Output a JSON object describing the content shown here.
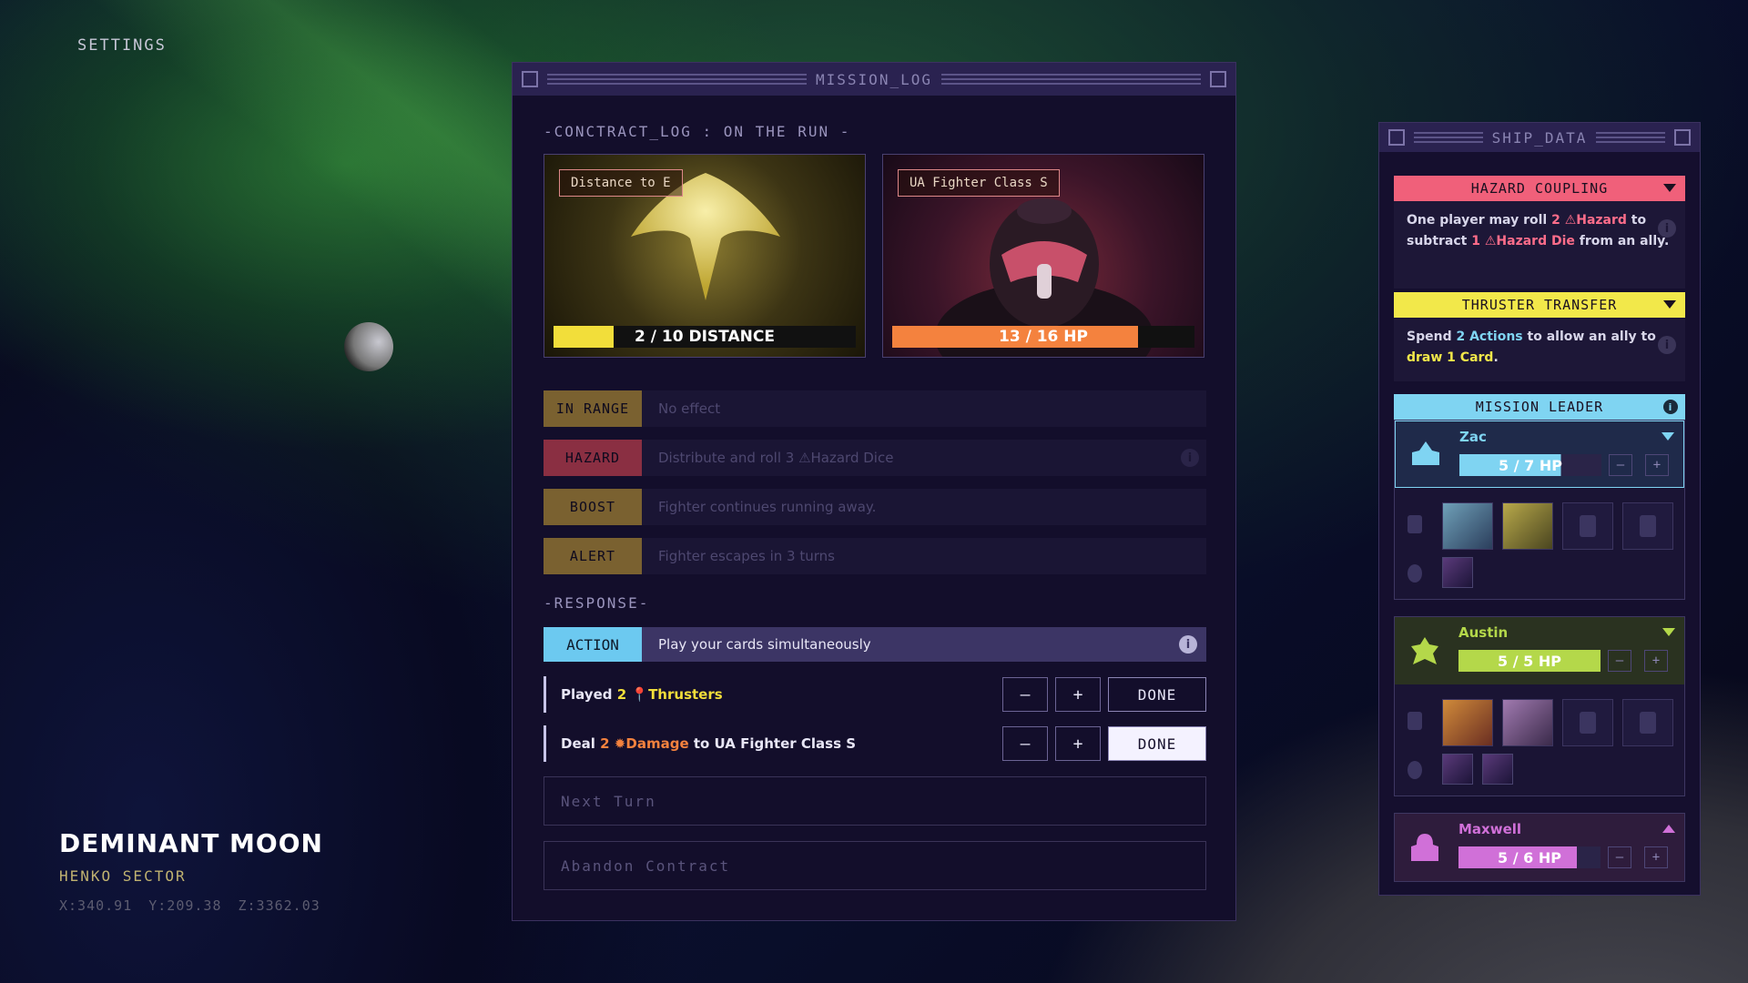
{
  "settings_label": "SETTINGS",
  "location": {
    "name": "DEMINANT MOON",
    "sector": "HENKO SECTOR",
    "coords": {
      "x": "X:340.91",
      "y": "Y:209.38",
      "z": "Z:3362.03"
    }
  },
  "mission_log": {
    "title": "MISSION_LOG",
    "contract_label": "-CONCTRACT_LOG : ON THE RUN -",
    "distance_card": {
      "tag": "Distance to E",
      "bar_text": "2 / 10 DISTANCE",
      "current": 2,
      "max": 10,
      "color": "#f2de3a"
    },
    "fighter_card": {
      "tag": "UA Fighter Class S",
      "bar_text": "13 / 16 HP",
      "current": 13,
      "max": 16,
      "color": "#f4823e"
    },
    "statuses": [
      {
        "label": "IN RANGE",
        "text": "No effect",
        "color": "#7a6130"
      },
      {
        "label": "HAZARD",
        "text": "Distribute and roll 3 ⚠Hazard Dice",
        "color": "#8a2f42"
      },
      {
        "label": "BOOST",
        "text": "Fighter continues running away.",
        "color": "#7a6130"
      },
      {
        "label": "ALERT",
        "text": "Fighter escapes in 3 turns",
        "color": "#7a6130"
      }
    ],
    "response_label": "-RESPONSE-",
    "action": {
      "label": "ACTION",
      "text": "Play your cards simultaneously"
    },
    "responses": [
      {
        "pre": "Played ",
        "num": "2",
        "icon": "📍",
        "kw": "Thrusters",
        "post": "",
        "kw_color": "#f2de3a",
        "done": "DONE",
        "active": false
      },
      {
        "pre": "Deal ",
        "num": "2",
        "icon": "✹",
        "kw": "Damage",
        "post": " to UA Fighter Class S",
        "kw_color": "#f4823e",
        "done": "DONE",
        "active": true
      }
    ],
    "minus": "–",
    "plus": "+",
    "next_turn": "Next Turn",
    "abandon": "Abandon Contract"
  },
  "ship_data": {
    "title": "SHIP_DATA",
    "hazard_coupling": {
      "title": "HAZARD COUPLING",
      "color": "#f0607a",
      "parts": [
        "One player may roll ",
        "2 ⚠Hazard",
        " to subtract ",
        "1 ⚠Hazard Die",
        " from an ally."
      ]
    },
    "thruster_transfer": {
      "title": "THRUSTER TRANSFER",
      "color": "#f2e84a",
      "parts": [
        "Spend ",
        "2 Actions",
        " to allow an ally to ",
        "draw 1 Card",
        "."
      ]
    },
    "mission_leader": {
      "title": "MISSION LEADER",
      "color": "#7fd4f2"
    },
    "players": [
      {
        "name": "Zac",
        "hp_text": "5 / 7 HP",
        "hp": 5,
        "hp_max": 7,
        "color": "#7fd4f2"
      },
      {
        "name": "Austin",
        "hp_text": "5 / 5 HP",
        "hp": 5,
        "hp_max": 5,
        "color": "#b4d84a"
      },
      {
        "name": "Maxwell",
        "hp_text": "5 / 6 HP",
        "hp": 5,
        "hp_max": 6,
        "color": "#d070d8"
      }
    ],
    "minus": "–",
    "plus": "+",
    "info": "i"
  }
}
